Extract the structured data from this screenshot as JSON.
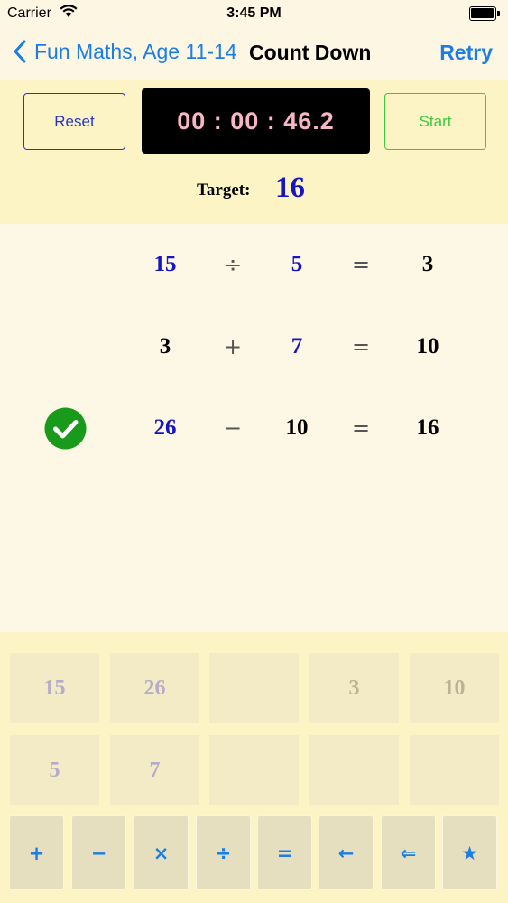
{
  "status_bar": {
    "carrier": "Carrier",
    "time": "3:45 PM"
  },
  "nav": {
    "back_label": "Fun Maths, Age 11-14",
    "title": "Count Down",
    "retry_label": "Retry"
  },
  "controls": {
    "reset_label": "Reset",
    "timer": "00 : 00 : 46.2",
    "start_label": "Start",
    "target_label": "Target:",
    "target_value": "16"
  },
  "equations": [
    {
      "a": "15",
      "op": "÷",
      "b": "5",
      "eq": "=",
      "result": "3",
      "solved": false
    },
    {
      "a": "3",
      "op": "+",
      "b": "7",
      "eq": "=",
      "result": "10",
      "solved": false
    },
    {
      "a": "26",
      "op": "−",
      "b": "10",
      "eq": "=",
      "result": "16",
      "solved": true
    }
  ],
  "tiles": {
    "row1": [
      "15",
      "26",
      "",
      "3",
      "10"
    ],
    "row2": [
      "5",
      "7",
      "",
      "",
      ""
    ]
  },
  "operators": [
    "+",
    "−",
    "×",
    "÷",
    "=",
    "←",
    "⇐",
    "★"
  ],
  "icons": {
    "back": "chevron-left-icon",
    "solved": "check-circle-icon",
    "wifi": "wifi-icon",
    "battery": "battery-icon"
  },
  "colors": {
    "accent": "#1a7ee6",
    "number_blue": "#1515c4",
    "timer_text": "#f7b6c6",
    "start_green": "#3ec83e",
    "check_green": "#1a9a1a"
  }
}
